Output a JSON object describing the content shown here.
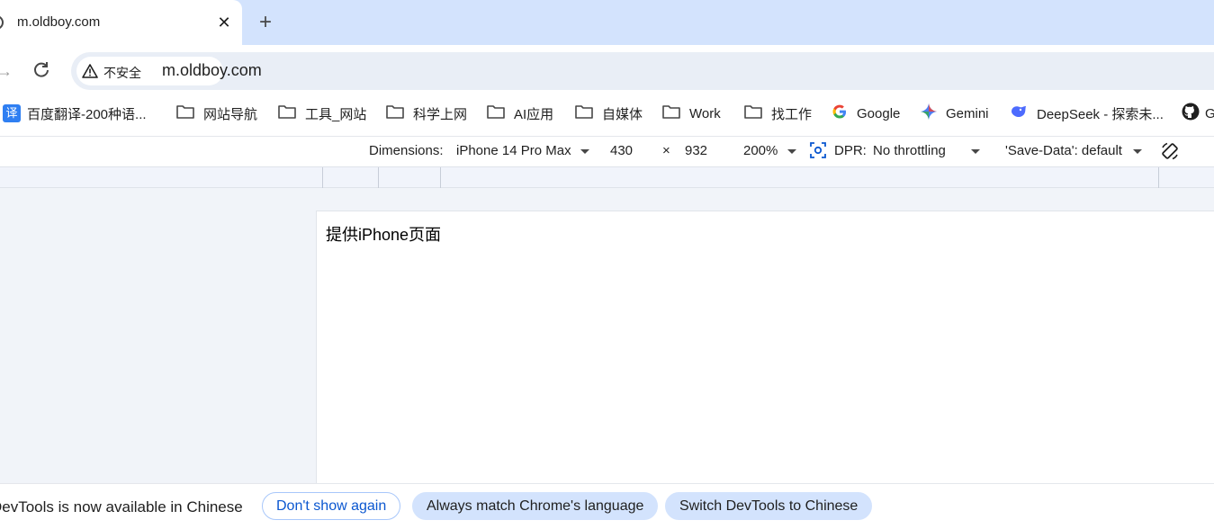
{
  "tab": {
    "title": "m.oldboy.com",
    "close": "✕",
    "new_tab": "+"
  },
  "toolbar": {
    "forward": "→",
    "security_label": "不安全",
    "url": "m.oldboy.com"
  },
  "bookmarks": [
    {
      "label": "百度翻译-200种语...",
      "icon": "fanyi-icon",
      "badge": "译"
    },
    {
      "label": "网站导航",
      "icon": "folder-icon"
    },
    {
      "label": "工具_网站",
      "icon": "folder-icon"
    },
    {
      "label": "科学上网",
      "icon": "folder-icon"
    },
    {
      "label": "AI应用",
      "icon": "folder-icon"
    },
    {
      "label": "自媒体",
      "icon": "folder-icon"
    },
    {
      "label": "Work",
      "icon": "folder-icon"
    },
    {
      "label": "找工作",
      "icon": "folder-icon"
    },
    {
      "label": "Google",
      "icon": "google-icon"
    },
    {
      "label": "Gemini",
      "icon": "gemini-icon"
    },
    {
      "label": "DeepSeek - 探索未...",
      "icon": "deepseek-icon"
    },
    {
      "label": "G",
      "icon": "github-icon"
    }
  ],
  "devtools": {
    "dimensions_label": "Dimensions:",
    "device": "iPhone 14 Pro Max",
    "width": "430",
    "times": "×",
    "height": "932",
    "zoom": "200%",
    "dpr_label": "DPR:",
    "throttling": "No throttling",
    "save_data": "'Save-Data': default"
  },
  "page": {
    "content": "提供iPhone页面"
  },
  "infobar": {
    "message": "DevTools is now available in Chinese",
    "dont_show": "Don't show again",
    "always_match": "Always match Chrome's language",
    "switch": "Switch DevTools to Chinese"
  },
  "colors": {
    "tabstrip": "#d3e3fd",
    "omnibox": "#e9eef6",
    "accent": "#0b57d0",
    "stage": "#f1f4f9"
  }
}
